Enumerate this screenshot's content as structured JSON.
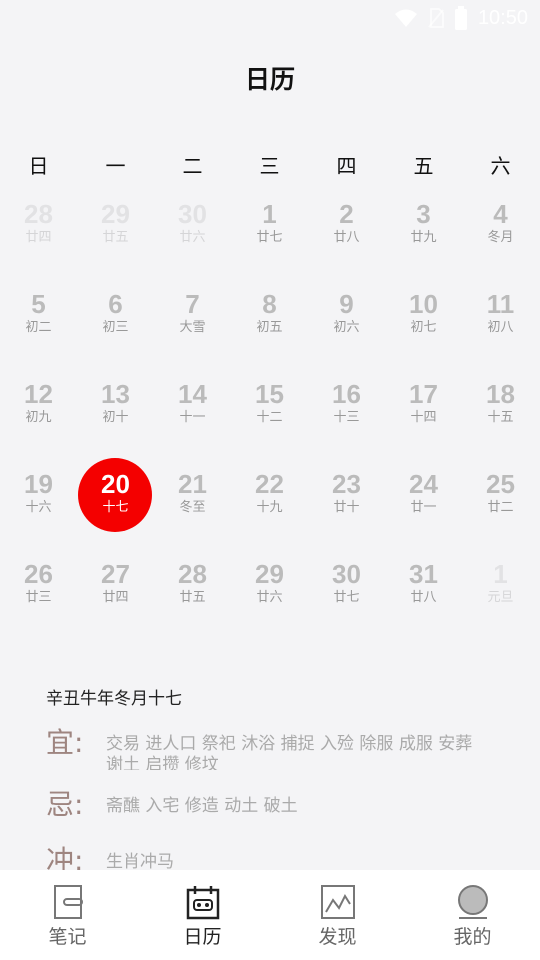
{
  "status_bar": {
    "time": "10:50"
  },
  "header": {
    "title": "日历"
  },
  "weekdays": [
    "日",
    "一",
    "二",
    "三",
    "四",
    "五",
    "六"
  ],
  "days": [
    {
      "num": "28",
      "lunar": "廿四",
      "other": true
    },
    {
      "num": "29",
      "lunar": "廿五",
      "other": true
    },
    {
      "num": "30",
      "lunar": "廿六",
      "other": true
    },
    {
      "num": "1",
      "lunar": "廿七"
    },
    {
      "num": "2",
      "lunar": "廿八"
    },
    {
      "num": "3",
      "lunar": "廿九"
    },
    {
      "num": "4",
      "lunar": "冬月"
    },
    {
      "num": "5",
      "lunar": "初二"
    },
    {
      "num": "6",
      "lunar": "初三"
    },
    {
      "num": "7",
      "lunar": "大雪"
    },
    {
      "num": "8",
      "lunar": "初五"
    },
    {
      "num": "9",
      "lunar": "初六"
    },
    {
      "num": "10",
      "lunar": "初七"
    },
    {
      "num": "11",
      "lunar": "初八"
    },
    {
      "num": "12",
      "lunar": "初九"
    },
    {
      "num": "13",
      "lunar": "初十"
    },
    {
      "num": "14",
      "lunar": "十一"
    },
    {
      "num": "15",
      "lunar": "十二"
    },
    {
      "num": "16",
      "lunar": "十三"
    },
    {
      "num": "17",
      "lunar": "十四"
    },
    {
      "num": "18",
      "lunar": "十五"
    },
    {
      "num": "19",
      "lunar": "十六"
    },
    {
      "num": "20",
      "lunar": "十七",
      "today": true
    },
    {
      "num": "21",
      "lunar": "冬至"
    },
    {
      "num": "22",
      "lunar": "十九"
    },
    {
      "num": "23",
      "lunar": "廿十"
    },
    {
      "num": "24",
      "lunar": "廿一"
    },
    {
      "num": "25",
      "lunar": "廿二"
    },
    {
      "num": "26",
      "lunar": "廿三"
    },
    {
      "num": "27",
      "lunar": "廿四"
    },
    {
      "num": "28",
      "lunar": "廿五"
    },
    {
      "num": "29",
      "lunar": "廿六"
    },
    {
      "num": "30",
      "lunar": "廿七"
    },
    {
      "num": "31",
      "lunar": "廿八"
    },
    {
      "num": "1",
      "lunar": "元旦",
      "other": true
    }
  ],
  "almanac": {
    "ganzhi": "辛丑牛年冬月十七",
    "yi_label": "宜:",
    "yi_text": "交易 进人口 祭祀 沐浴 捕捉 入殓 除服 成服 安葬 谢土 启攒 修坟",
    "ji_label": "忌:",
    "ji_text": "斋醮 入宅 修造 动土 破土",
    "chong_label": "冲:",
    "chong_text": "生肖冲马"
  },
  "tabs": {
    "notes": "笔记",
    "calendar": "日历",
    "discover": "发现",
    "mine": "我的"
  },
  "colors": {
    "accent": "#f40000",
    "background": "#f4f4f6"
  }
}
